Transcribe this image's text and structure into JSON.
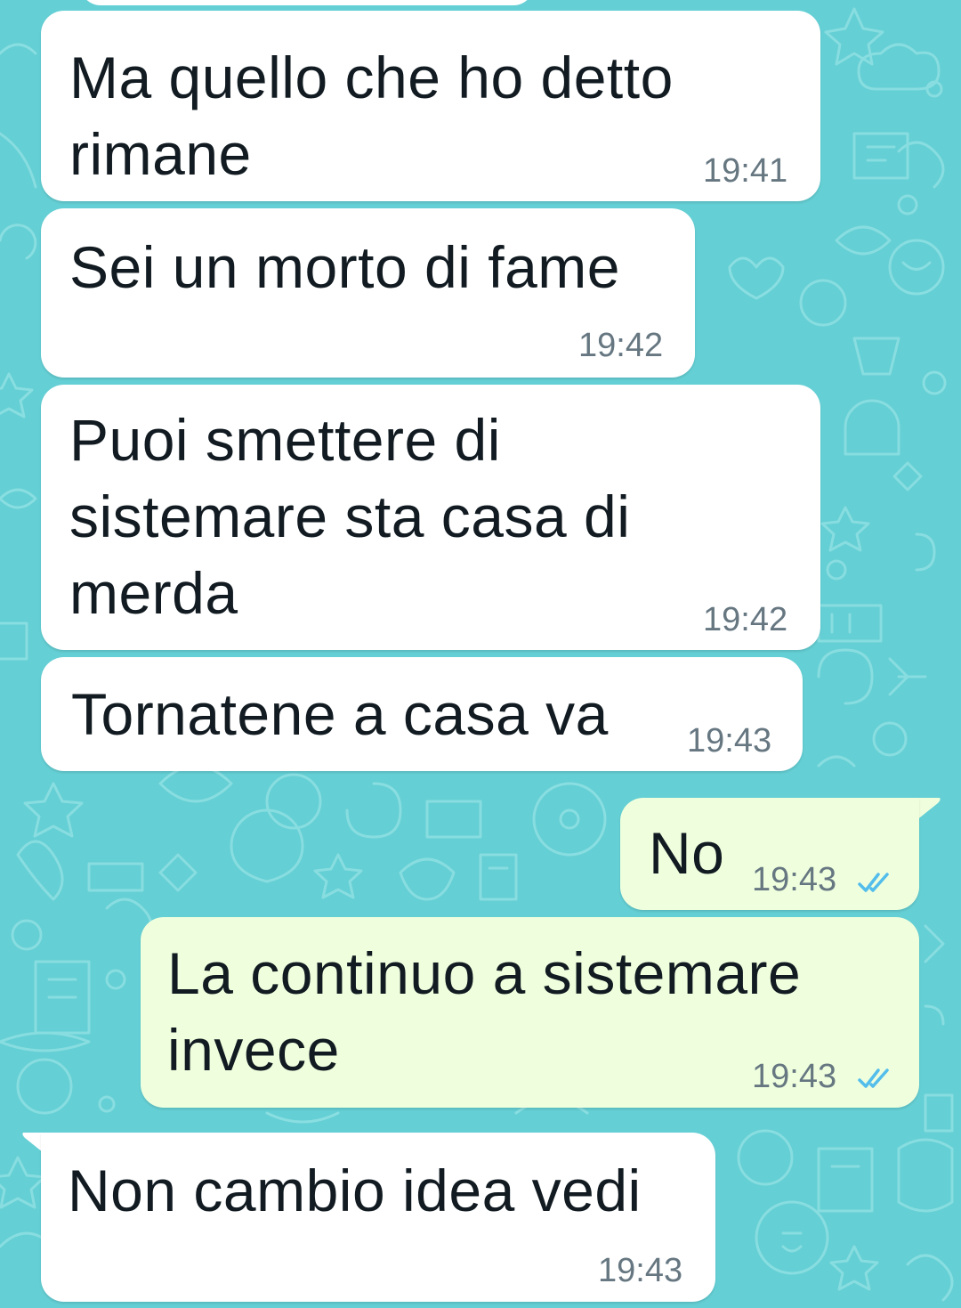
{
  "chat": {
    "messages": [
      {
        "direction": "incoming",
        "text": "Ma quello che ho detto\nrimane",
        "time": "19:41"
      },
      {
        "direction": "incoming",
        "text": "Sei un morto di fame",
        "time": "19:42"
      },
      {
        "direction": "incoming",
        "text": "Puoi smettere di\nsistemare sta casa di\nmerda",
        "time": "19:42"
      },
      {
        "direction": "incoming",
        "text": "Tornatene a casa va",
        "time": "19:43"
      },
      {
        "direction": "outgoing",
        "text": "No",
        "time": "19:43",
        "status": "read"
      },
      {
        "direction": "outgoing",
        "text": "La continuo a sistemare\ninvece",
        "time": "19:43",
        "status": "read"
      },
      {
        "direction": "incoming",
        "text": "Non cambio idea vedi",
        "time": "19:43"
      }
    ]
  },
  "colors": {
    "wallpaper": "#64cfd4",
    "incoming_bubble": "#ffffff",
    "outgoing_bubble": "#efffde",
    "text": "#111b21",
    "time": "#667781",
    "read_ticks": "#53bdeb"
  },
  "icons": {
    "read_receipt": "double-check-icon",
    "wallpaper_pattern": "doodle-pattern"
  }
}
